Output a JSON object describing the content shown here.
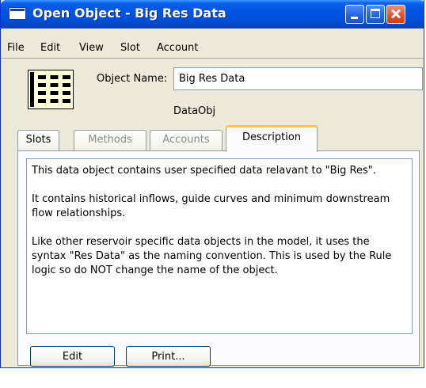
{
  "window": {
    "title": "Open Object - Big Res Data"
  },
  "menu": {
    "items": [
      "File",
      "Edit",
      "View",
      "Slot",
      "Account"
    ]
  },
  "object": {
    "name_label": "Object Name:",
    "name_value": "Big Res Data",
    "type": "DataObj"
  },
  "tabs": [
    {
      "label": "Slots",
      "state": "normal"
    },
    {
      "label": "Methods",
      "state": "disabled"
    },
    {
      "label": "Accounts",
      "state": "disabled"
    },
    {
      "label": "Description",
      "state": "selected"
    }
  ],
  "description": {
    "paragraphs": [
      "This data object contains user specified data relavant to \"Big Res\".",
      "It contains historical inflows, guide curves and minimum downstream flow relationships.",
      "Like other reservoir specific data objects in the model, it uses the syntax \"Res Data\" as the naming convention. This is used by the Rule logic so do NOT change the name of the object."
    ]
  },
  "buttons": {
    "edit": "Edit",
    "print": "Print..."
  },
  "colors": {
    "titlebar": "#0054e3",
    "window_bg": "#ece9d8",
    "active_tab_accent": "#ffc83c",
    "close_button": "#e3552e"
  }
}
